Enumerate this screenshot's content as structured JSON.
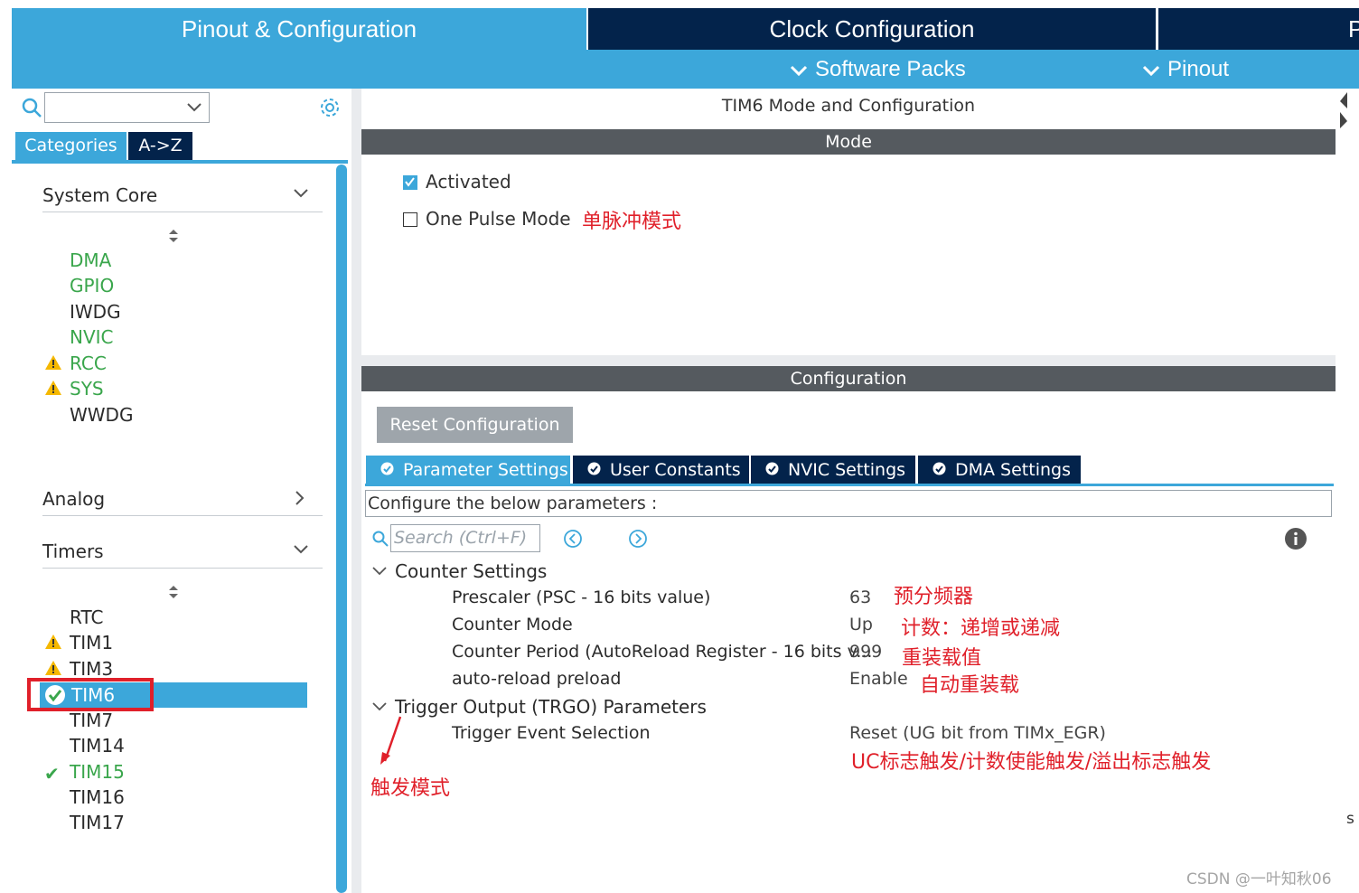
{
  "top_tabs": {
    "pinout_config": "Pinout & Configuration",
    "clock_config": "Clock Configuration",
    "project_manager_partial": "P"
  },
  "sub_menu": {
    "software_packs": "Software Packs",
    "pinout": "Pinout"
  },
  "left_panel": {
    "tabs": {
      "categories": "Categories",
      "az": "A->Z"
    },
    "system_core": {
      "label": "System Core",
      "items": [
        {
          "label": "DMA",
          "status": "green"
        },
        {
          "label": "GPIO",
          "status": "green"
        },
        {
          "label": "IWDG",
          "status": "none"
        },
        {
          "label": "NVIC",
          "status": "green"
        },
        {
          "label": "RCC",
          "status": "warning"
        },
        {
          "label": "SYS",
          "status": "warning"
        },
        {
          "label": "WWDG",
          "status": "none"
        }
      ]
    },
    "analog": {
      "label": "Analog"
    },
    "timers": {
      "label": "Timers",
      "items": [
        {
          "label": "RTC",
          "status": "none"
        },
        {
          "label": "TIM1",
          "status": "warning"
        },
        {
          "label": "TIM3",
          "status": "warning"
        },
        {
          "label": "TIM6",
          "status": "selected-ok"
        },
        {
          "label": "TIM7",
          "status": "none"
        },
        {
          "label": "TIM14",
          "status": "none"
        },
        {
          "label": "TIM15",
          "status": "ok-green"
        },
        {
          "label": "TIM16",
          "status": "none"
        },
        {
          "label": "TIM17",
          "status": "none"
        }
      ]
    }
  },
  "right_panel": {
    "title": "TIM6 Mode and Configuration",
    "mode_header": "Mode",
    "activated_label": "Activated",
    "activated_checked": true,
    "one_pulse_label": "One Pulse Mode",
    "one_pulse_checked": false,
    "config_header": "Configuration",
    "reset_button": "Reset Configuration",
    "param_tabs": [
      "Parameter Settings",
      "User Constants",
      "NVIC Settings",
      "DMA Settings"
    ],
    "configure_text": "Configure the below parameters :",
    "search_placeholder": "Search (Ctrl+F)",
    "counter_settings": {
      "label": "Counter Settings",
      "rows": [
        {
          "name": "Prescaler (PSC - 16 bits value)",
          "value": "63"
        },
        {
          "name": "Counter Mode",
          "value": "Up"
        },
        {
          "name": "Counter Period (AutoReload Register - 16 bits v...",
          "value": "999"
        },
        {
          "name": "auto-reload preload",
          "value": "Enable"
        }
      ]
    },
    "trgo": {
      "label": "Trigger Output (TRGO) Parameters",
      "rows": [
        {
          "name": "Trigger Event Selection",
          "value": "Reset (UG bit from TIMx_EGR)"
        }
      ]
    }
  },
  "annotations": {
    "one_pulse": "单脉冲模式",
    "prescaler": "预分频器",
    "counter_mode": "计数：递增或递减",
    "period": "重装载值",
    "preload": "自动重装载",
    "trigger_event": "UC标志触发/计数使能触发/溢出标志触发",
    "trigger_mode": "触发模式"
  },
  "edge_text": "s",
  "watermark": "CSDN @一叶知秋06",
  "colors": {
    "accent_blue": "#3ca7da",
    "dark_navy": "#03234b",
    "header_gray": "#555a5f",
    "annotation_red": "#e0202a",
    "ok_green": "#3aa64c",
    "warning_yellow": "#f5b800"
  }
}
